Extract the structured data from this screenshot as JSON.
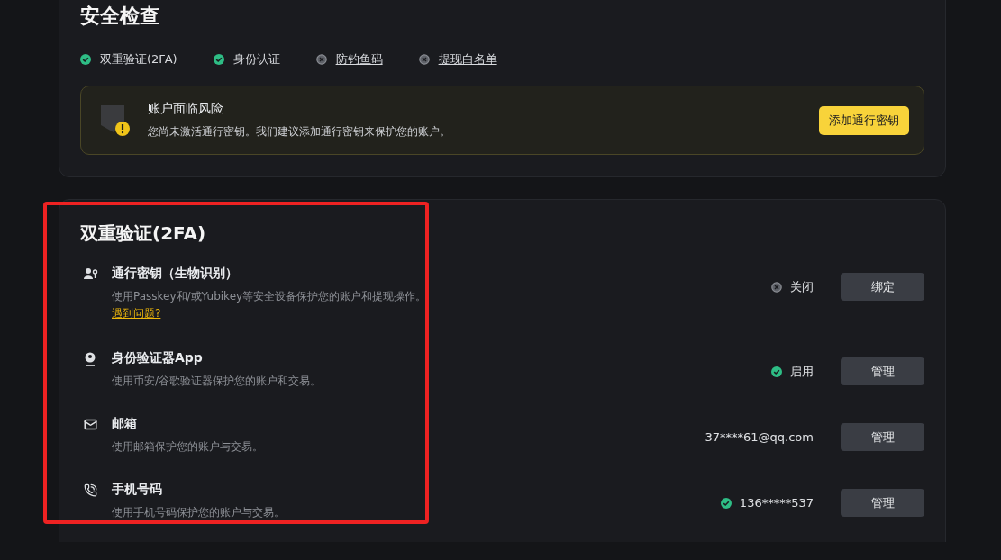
{
  "security_check": {
    "title": "安全检查",
    "items": [
      {
        "label": "双重验证(2FA)",
        "done": true
      },
      {
        "label": "身份认证",
        "done": true
      },
      {
        "label": "防钓鱼码",
        "done": false
      },
      {
        "label": "提现白名单",
        "done": false
      }
    ],
    "alert": {
      "title": "账户面临风险",
      "message": "您尚未激活通行密钥。我们建议添加通行密钥来保护您的账户。",
      "button": "添加通行密钥"
    }
  },
  "two_factor": {
    "title": "双重验证(2FA)",
    "methods": [
      {
        "kind": "passkey",
        "name": "通行密钥（生物识别）",
        "description": "使用Passkey和/或Yubikey等安全设备保护您的账户和提现操作。",
        "help_link": "遇到问题?",
        "status_on": false,
        "value": "关闭",
        "button": "绑定"
      },
      {
        "kind": "authenticator",
        "name": "身份验证器App",
        "description": "使用币安/谷歌验证器保护您的账户和交易。",
        "status_on": true,
        "value": "启用",
        "button": "管理"
      },
      {
        "kind": "email",
        "name": "邮箱",
        "description": "使用邮箱保护您的账户与交易。",
        "value": "37****61@qq.com",
        "button": "管理"
      },
      {
        "kind": "phone",
        "name": "手机号码",
        "description": "使用手机号码保护您的账户与交易。",
        "status_on": true,
        "value": "136*****537",
        "button": "管理"
      }
    ]
  }
}
